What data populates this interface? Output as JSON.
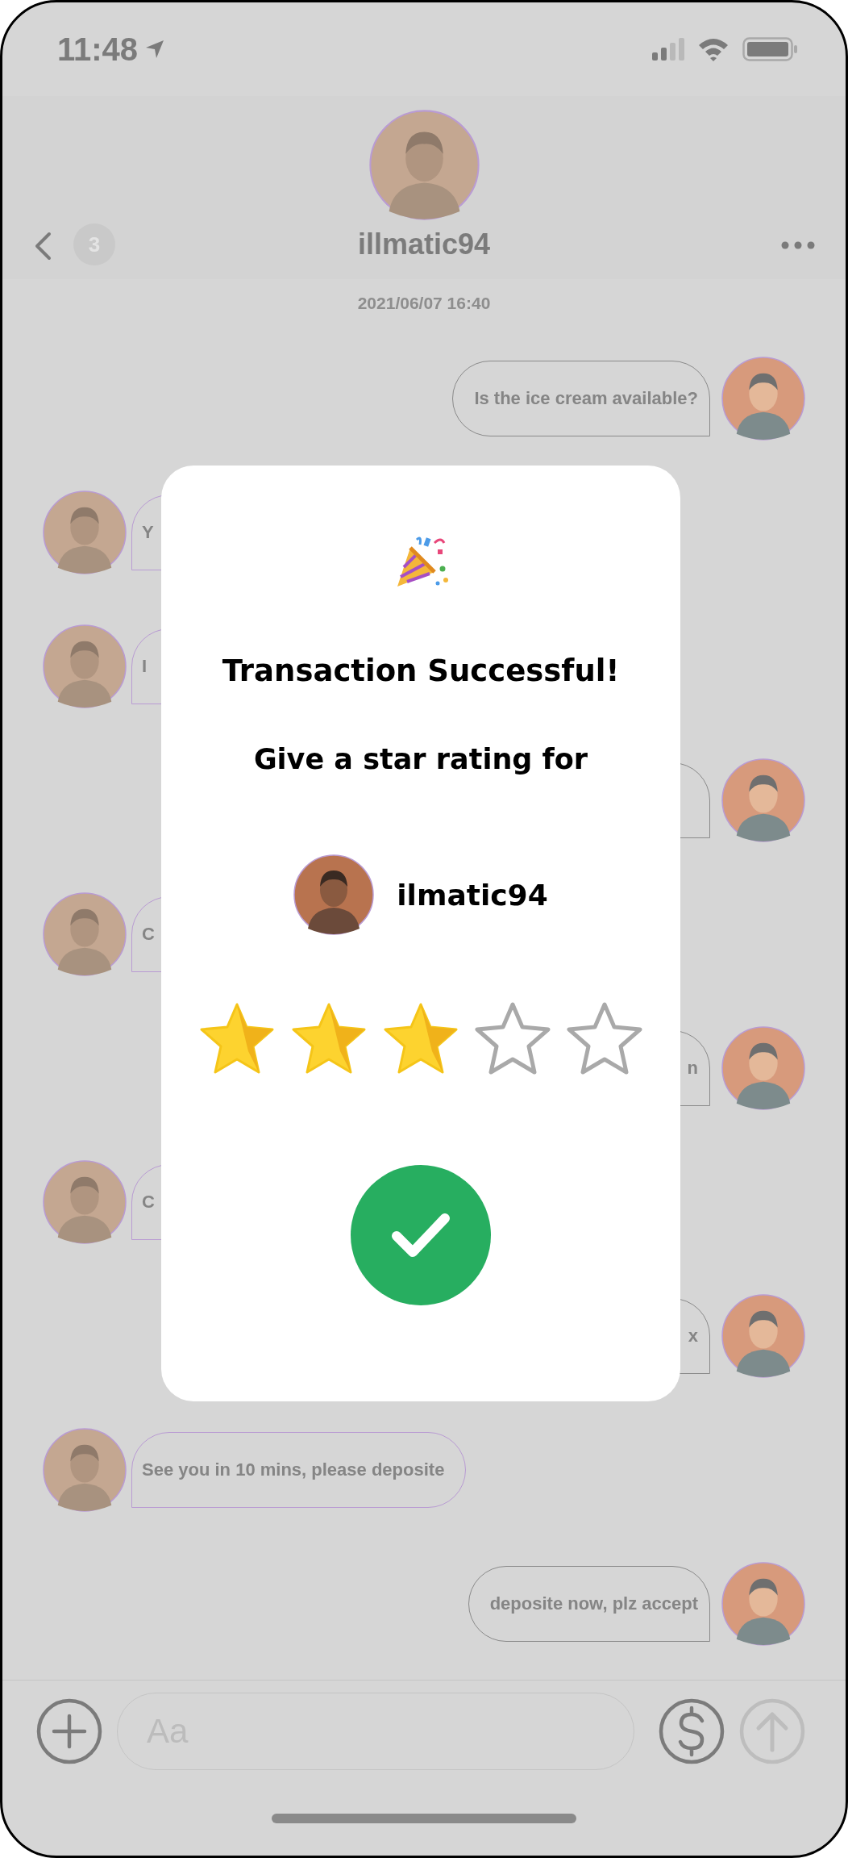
{
  "status_bar": {
    "time": "11:48"
  },
  "header": {
    "unread_count": "3",
    "name": "illmatic94"
  },
  "timestamp": "2021/06/07 16:40",
  "messages": [
    {
      "kind": "outgoing",
      "text": "Is the ice cream available?"
    },
    {
      "kind": "incoming",
      "text": "Y"
    },
    {
      "kind": "incoming",
      "text": "I"
    },
    {
      "kind": "outgoing"
    },
    {
      "kind": "incoming",
      "text": "C"
    },
    {
      "kind": "outgoing",
      "text": "n"
    },
    {
      "kind": "incoming",
      "text": "C"
    },
    {
      "kind": "outgoing",
      "text": "x"
    },
    {
      "kind": "incoming",
      "text": "See you in 10 mins, please deposite"
    },
    {
      "kind": "outgoing",
      "text": "deposite now, plz accept"
    }
  ],
  "composer": {
    "placeholder": "Aa"
  },
  "modal": {
    "title": "Transaction Successful!",
    "prompt": "Give a star rating for",
    "user": "ilmatic94",
    "stars": 3
  }
}
